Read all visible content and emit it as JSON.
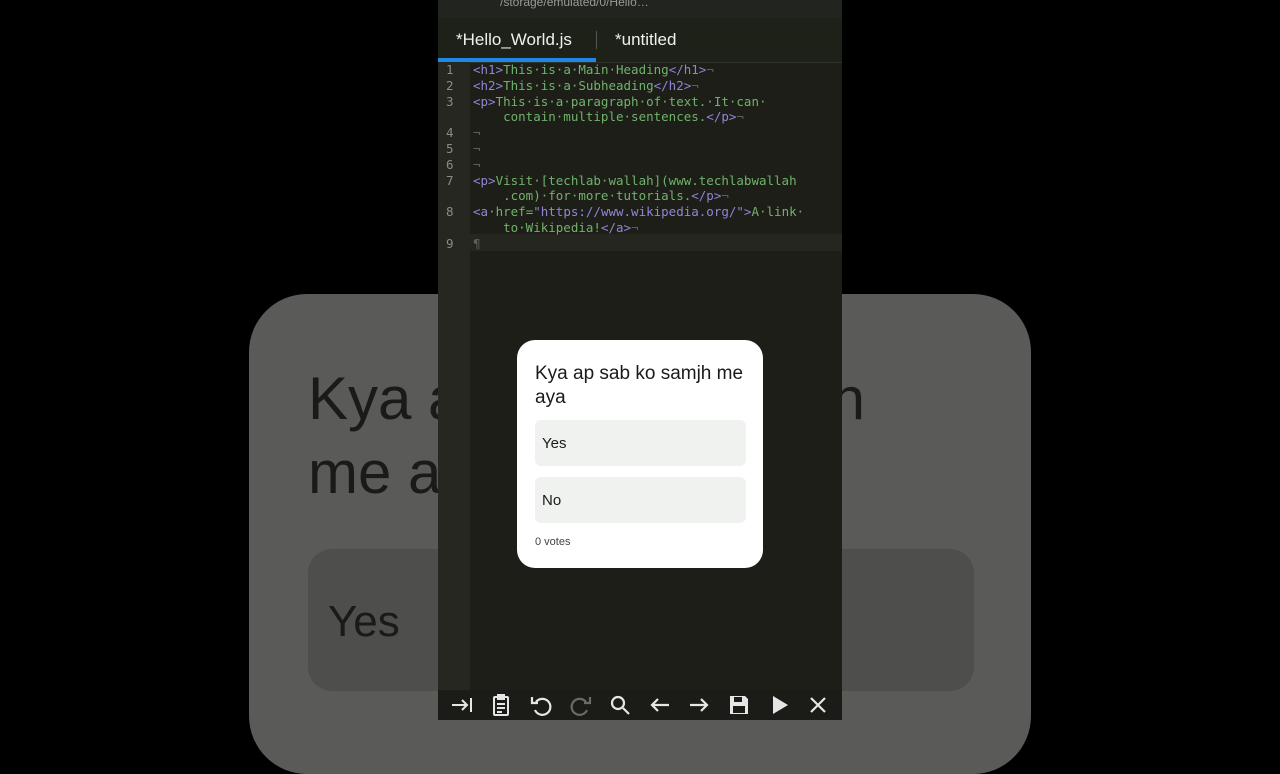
{
  "background_poll": {
    "question": "Kya ap sab ko samjh me aya",
    "option_label": "Yes"
  },
  "editor": {
    "path": "/storage/emulated/0/Hello…",
    "tabs": [
      {
        "label": "*Hello_World.js",
        "active": true
      },
      {
        "label": "*untitled",
        "active": false
      }
    ],
    "line_numbers": [
      "1",
      "2",
      "3",
      "4",
      "5",
      "6",
      "7",
      "8",
      "9"
    ]
  },
  "poll": {
    "question": "Kya ap sab ko samjh me aya",
    "options": [
      {
        "label": "Yes"
      },
      {
        "label": "No"
      }
    ],
    "votes": "0 votes"
  },
  "toolbar": {
    "buttons": [
      "tab-indent-icon",
      "clipboard-icon",
      "undo-icon",
      "redo-icon",
      "search-icon",
      "arrow-left-icon",
      "arrow-right-icon",
      "save-icon",
      "play-icon",
      "close-icon"
    ]
  },
  "colors": {
    "accent": "#1e88e5",
    "tag": "#8f86d9",
    "text": "#6fb26b",
    "string": "#d9a75c"
  }
}
